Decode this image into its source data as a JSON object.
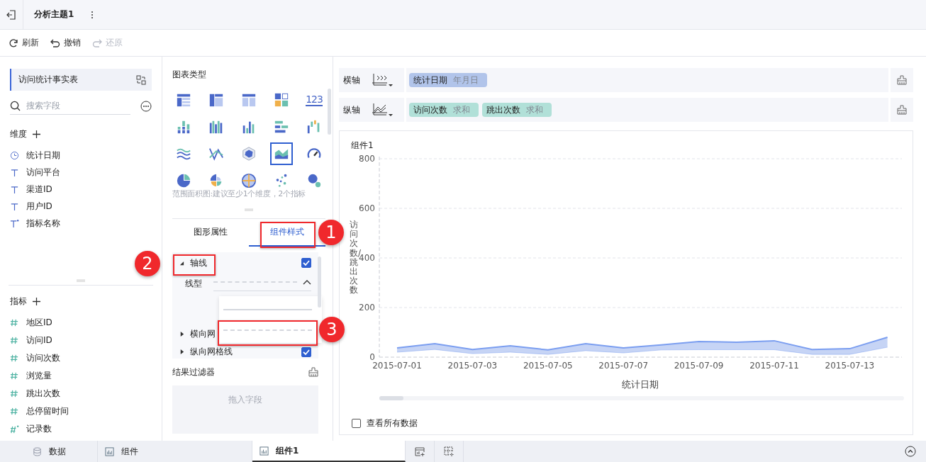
{
  "topbar": {
    "title": "分析主题1"
  },
  "toolbar": [
    {
      "label": "刷新",
      "kind": "refresh",
      "disabled": false
    },
    {
      "label": "撤销",
      "kind": "undo",
      "disabled": false
    },
    {
      "label": "还原",
      "kind": "redo",
      "disabled": true
    }
  ],
  "data_panel": {
    "table": "访问统计事实表",
    "search": {
      "placeholder": "搜索字段"
    },
    "dimensions": {
      "title": "维度",
      "items": [
        {
          "label": "统计日期",
          "kind": "date"
        },
        {
          "label": "访问平台",
          "kind": "text"
        },
        {
          "label": "渠道ID",
          "kind": "text"
        },
        {
          "label": "用户ID",
          "kind": "text"
        },
        {
          "label": "指标名称",
          "kind": "text-calc"
        }
      ]
    },
    "metrics": {
      "title": "指标",
      "items": [
        {
          "label": "地区ID",
          "kind": "number"
        },
        {
          "label": "访问ID",
          "kind": "number"
        },
        {
          "label": "访问次数",
          "kind": "number"
        },
        {
          "label": "浏览量",
          "kind": "number"
        },
        {
          "label": "跳出次数",
          "kind": "number"
        },
        {
          "label": "总停留时间",
          "kind": "number"
        },
        {
          "label": "记录数",
          "kind": "number-calc"
        }
      ]
    }
  },
  "chart_types": {
    "title": "图表类型",
    "items": [
      {
        "kind": "table",
        "selected": false
      },
      {
        "kind": "cross-table",
        "selected": false
      },
      {
        "kind": "detail-table",
        "selected": false
      },
      {
        "kind": "kpi-grid",
        "selected": false
      },
      {
        "kind": "number",
        "label": "123",
        "selected": false
      },
      {
        "kind": "stacked-bar",
        "selected": false
      },
      {
        "kind": "multi-bar",
        "selected": false
      },
      {
        "kind": "bar",
        "selected": false
      },
      {
        "kind": "horizontal-bar",
        "selected": false
      },
      {
        "kind": "waterfall",
        "selected": false
      },
      {
        "kind": "wave",
        "selected": false
      },
      {
        "kind": "cross-line",
        "selected": false
      },
      {
        "kind": "radar",
        "selected": false
      },
      {
        "kind": "range-area",
        "selected": true
      },
      {
        "kind": "gauge",
        "selected": false
      },
      {
        "kind": "pie",
        "selected": false
      },
      {
        "kind": "rose",
        "selected": false
      },
      {
        "kind": "globe",
        "selected": false
      },
      {
        "kind": "scatter",
        "selected": false
      },
      {
        "kind": "bubble",
        "selected": false
      }
    ],
    "hint": "范围面积图:建议至少1个维度，2个指标"
  },
  "settings": {
    "tabs": [
      {
        "label": "图形属性",
        "selected": false
      },
      {
        "label": "组件样式",
        "selected": true
      }
    ],
    "sections": [
      {
        "label": "轴线",
        "expanded": true,
        "checked": true
      },
      {
        "label": "横向网",
        "expanded": false
      },
      {
        "label": "纵向网格线",
        "expanded": false,
        "checked": true
      }
    ],
    "line_type": {
      "label": "线型",
      "kind": "dashed",
      "open": true,
      "options": [
        {
          "kind": "solid"
        },
        {
          "kind": "dashed"
        }
      ]
    }
  },
  "filter": {
    "title": "结果过滤器",
    "placeholder": "拖入字段"
  },
  "axes": [
    {
      "label": "横轴",
      "fields": [
        {
          "name": "统计日期",
          "aggregate": "年月日",
          "color": "#b1c4ea"
        }
      ]
    },
    {
      "label": "纵轴",
      "fields": [
        {
          "name": "访问次数",
          "aggregate": "求和",
          "color": "#b1e0d8"
        },
        {
          "name": "跳出次数",
          "aggregate": "求和",
          "color": "#b1e0d8"
        }
      ]
    }
  ],
  "component": {
    "title": "组件1",
    "show_all": {
      "label": "查看所有数据",
      "checked": false
    },
    "chart_data": {
      "type": "area",
      "xlabel": "统计日期",
      "ylabel": "访问次数/跳出次数",
      "categories": [
        "2015-07-01",
        null,
        "2015-07-03",
        null,
        "2015-07-05",
        null,
        "2015-07-07",
        null,
        "2015-07-09",
        null,
        "2015-07-11",
        null,
        "2015-07-13",
        null
      ],
      "series": [
        {
          "type": "area",
          "color": "#7b9ef0",
          "values": [
            37,
            54,
            31,
            46,
            29,
            54,
            37,
            49,
            63,
            60,
            66,
            31,
            34,
            80
          ]
        },
        {
          "type": "line",
          "color": "#7b9ef0",
          "values": [
            20,
            31,
            14,
            20,
            11,
            26,
            17,
            29,
            30,
            30,
            30,
            11,
            11,
            40
          ]
        }
      ],
      "ylim": [
        0,
        800
      ],
      "yticks": [
        0,
        200,
        400,
        600,
        800
      ],
      "grid": true
    }
  },
  "bottom_tabs": [
    {
      "label": "数据",
      "kind": "data",
      "selected": false
    },
    {
      "label": "组件",
      "kind": "chart",
      "selected": false
    },
    {
      "label": "组件1",
      "kind": "chart",
      "selected": true
    }
  ],
  "annotations": [
    {
      "label": "1"
    },
    {
      "label": "2"
    },
    {
      "label": "3"
    }
  ]
}
